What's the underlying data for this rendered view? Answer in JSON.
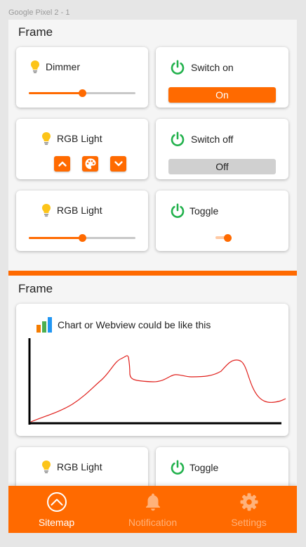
{
  "canvas": {
    "device_label": "Google Pixel 2 - 1"
  },
  "colors": {
    "accent": "#ff6a00",
    "power_green": "#22b14c",
    "bulb_yellow": "#fcc419",
    "chart_line": "#e0201c"
  },
  "frame1": {
    "title": "Frame",
    "dimmer": {
      "label": "Dimmer",
      "level": 0.5
    },
    "switch_on": {
      "label": "Switch on",
      "button": "On"
    },
    "rgb_light_1": {
      "label": "RGB Light"
    },
    "switch_off": {
      "label": "Switch off",
      "button": "Off"
    },
    "rgb_light_2": {
      "label": "RGB Light",
      "level": 0.5
    },
    "toggle": {
      "label": "Toggle",
      "on": true
    }
  },
  "frame2": {
    "title": "Frame",
    "chart": {
      "label": "Chart or Webview could be like this"
    },
    "rgb_light": {
      "label": "RGB Light"
    },
    "toggle": {
      "label": "Toggle"
    }
  },
  "nav": {
    "items": [
      {
        "label": "Sitemap",
        "icon": "sitemap-icon",
        "active": true
      },
      {
        "label": "Notification",
        "icon": "bell-icon",
        "active": false
      },
      {
        "label": "Settings",
        "icon": "gear-icon",
        "active": false
      }
    ]
  }
}
